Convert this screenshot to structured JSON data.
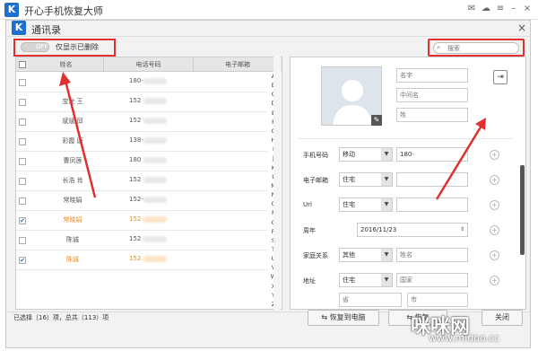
{
  "app": {
    "logo_letter": "K",
    "title": "开心手机恢复大师"
  },
  "dialog": {
    "logo_letter": "K",
    "title": "通讯录",
    "close_glyph": "×"
  },
  "toolbar": {
    "toggle_text": "OFF",
    "toggle_label": "仅显示已删除",
    "search_placeholder": "搜索"
  },
  "list": {
    "headers": [
      "姓名",
      "电话号码",
      "电子邮箱"
    ],
    "rows": [
      {
        "name": "",
        "phone": "180-",
        "checked": false,
        "highlight": false
      },
      {
        "name": "宝龙 王",
        "phone": "152",
        "checked": false,
        "highlight": false
      },
      {
        "name": "斌斌 邱",
        "phone": "152",
        "checked": false,
        "highlight": false
      },
      {
        "name": "彩霞 唐",
        "phone": "138-",
        "checked": false,
        "highlight": false
      },
      {
        "name": "曹凤莲",
        "phone": "180",
        "checked": false,
        "highlight": false
      },
      {
        "name": "长浩 肖",
        "phone": "152",
        "checked": false,
        "highlight": false
      },
      {
        "name": "常晓娟",
        "phone": "152-",
        "checked": false,
        "highlight": false
      },
      {
        "name": "常晓娟",
        "phone": "152",
        "checked": true,
        "highlight": true
      },
      {
        "name": "陈诚",
        "phone": "152",
        "checked": false,
        "highlight": false
      },
      {
        "name": "陈诚",
        "phone": "152",
        "checked": true,
        "highlight": true
      }
    ],
    "alphabet": [
      "A",
      "B",
      "C",
      "D",
      "E",
      "F",
      "G",
      "H",
      "I",
      "J",
      "K",
      "L",
      "M",
      "N",
      "O",
      "P",
      "Q",
      "R",
      "S",
      "T",
      "U",
      "V",
      "W",
      "X",
      "Y",
      "Z"
    ]
  },
  "detail": {
    "name_placeholders": {
      "first": "名字",
      "middle": "中间名",
      "last": "姓"
    },
    "phone": {
      "label": "手机号码",
      "type": "移动",
      "value": "180-"
    },
    "email": {
      "label": "电子邮箱",
      "type": "住宅"
    },
    "url": {
      "label": "Url",
      "type": "住宅"
    },
    "anniversary": {
      "label": "周年",
      "value": "2016/11/23"
    },
    "family": {
      "label": "家庭关系",
      "type": "其他",
      "placeholder": "姓名"
    },
    "address": {
      "label": "地址",
      "type": "住宅",
      "country_placeholder": "国家",
      "province_placeholder": "省",
      "city_placeholder": "市"
    }
  },
  "footer": {
    "status": "已选择（16）项，总共（113）项",
    "restore_pc": "恢复到电脑",
    "restore_device": "恢复",
    "close": "关闭"
  },
  "watermark": {
    "text": "咪咪网",
    "url": "www.midoo.cc"
  },
  "colors": {
    "accent": "#1e6fd0",
    "highlight": "#f08a24",
    "annotation": "#e03030"
  }
}
